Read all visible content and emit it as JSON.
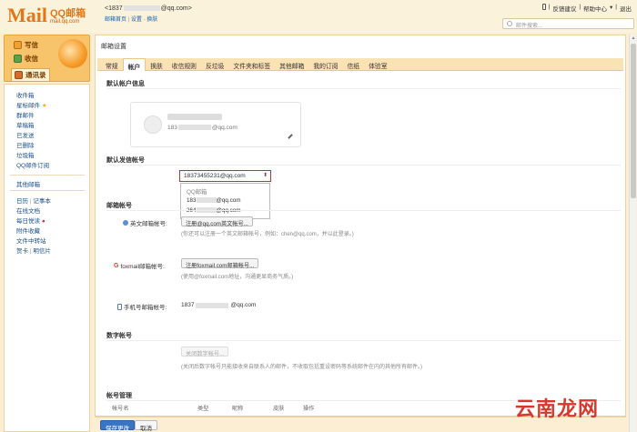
{
  "header": {
    "logo_mail": "Mail",
    "logo_qq": "QQ邮箱",
    "logo_url": "mail.qq.com",
    "user_email_prefix": "<1837",
    "user_email_suffix": "@qq.com>",
    "nav_home": "邮箱首页",
    "nav_sep1": " | ",
    "nav_settings": "设置",
    "nav_sep2": " - ",
    "nav_skin": "换肤",
    "top_links": [
      "反馈建议",
      "帮助中心",
      "退出"
    ],
    "search_placeholder": "邮件搜索..."
  },
  "left": {
    "compose": "写信",
    "inbox": "收信",
    "contacts": "通讯录",
    "folders": [
      "收件箱",
      "星标邮件",
      "群邮件",
      "草稿箱",
      "已发送",
      "已删除",
      "垃圾箱",
      "QQ邮件订阅"
    ],
    "other": "其他邮箱",
    "tools": [
      "日历",
      "记事本",
      "在线文档",
      "每日悦读",
      "附件收藏",
      "文件中转站",
      "贺卡",
      "明信片"
    ],
    "tool_sep": "|"
  },
  "main": {
    "title": "邮箱设置",
    "tabs": [
      "常规",
      "帐户",
      "换肤",
      "收信规则",
      "反垃圾",
      "文件夹和标签",
      "其他邮箱",
      "我的订阅",
      "信纸",
      "体验室"
    ],
    "sec_default_account": "默认帐户信息",
    "card_email_prefix": "183",
    "card_email_suffix": "@qq.com",
    "sec_sender": "默认发信帐号",
    "sender_selected": "18373455231@qq.com",
    "dropdown_header": "QQ邮箱",
    "dropdown_opt1_prefix": "183",
    "dropdown_opt1_suffix": "@qq.com",
    "dropdown_opt2_prefix": "264",
    "dropdown_opt2_suffix": "@qq.com",
    "sec_mail_accounts": "邮箱帐号",
    "english_label": "英文邮箱帐号:",
    "english_btn": "注册@qq.com英文帐号...",
    "english_hint": "(你还可以注册一个英文邮箱帐号，例如：chen@qq.com，并以此登录。)",
    "foxmail_label": "foxmail邮箱帐号:",
    "foxmail_btn": "注册foxmail.com邮箱帐号...",
    "foxmail_hint": "(使用@foxmail.com地址，沟通更显商务气质。)",
    "mobile_label": "手机号邮箱帐号:",
    "mobile_value_prefix": "1837",
    "mobile_value_suffix": "@qq.com",
    "sec_number": "数字帐号",
    "number_btn": "关闭数字帐号...",
    "number_hint": "(关闭后数字帐号只能接收来自联系人的邮件，不收取包括重设密码等系统邮件在内的其他所有邮件。)",
    "sec_manage": "帐号管理",
    "table_headers": [
      "帐号名",
      "类型",
      "昵称",
      "皮肤",
      "操作"
    ]
  },
  "bottom": {
    "save": "保存更改",
    "cancel": "取消"
  },
  "watermark": "云南龙网"
}
